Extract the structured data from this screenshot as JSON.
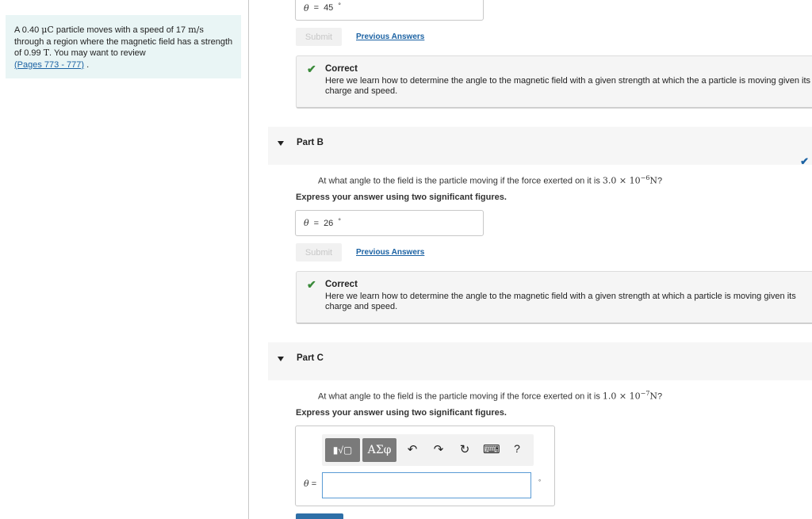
{
  "problem": {
    "text_prefix": "A 0.40 ",
    "charge_unit": "μC",
    "text_mid1": " particle moves with a speed of 17 ",
    "speed_unit": "m/s",
    "text_mid2": " through a region where the magnetic field has a strength of 0.99 ",
    "field_unit": "T",
    "text_mid3": ". You may want to review",
    "link": "(Pages 773 - 777)",
    "text_end": " ."
  },
  "partA": {
    "theta_symbol": "θ",
    "eq": "=",
    "answer": "45",
    "degree": "°",
    "submit": "Submit",
    "previous": "Previous Answers",
    "feedback_title": "Correct",
    "feedback_text": "Here we learn how to determine the angle to the magnetic field with a given strength at which the a particle is moving given its charge and speed."
  },
  "partB": {
    "label": "Part B",
    "question_prefix": "At what angle to the field is the particle moving if the force exerted on it is ",
    "force_value": "3.0 × 10",
    "force_exp": "−6",
    "force_unit": "N",
    "question_end": "?",
    "instruction": "Express your answer using two significant figures.",
    "theta_symbol": "θ",
    "eq": "=",
    "answer": "26",
    "degree": "°",
    "submit": "Submit",
    "previous": "Previous Answers",
    "feedback_title": "Correct",
    "feedback_text": "Here we learn how to determine the angle to the magnetic field with a given strength at which a particle is moving given its charge and speed."
  },
  "partC": {
    "label": "Part C",
    "question_prefix": "At what angle to the field is the particle moving if the force exerted on it is ",
    "force_value": "1.0 × 10",
    "force_exp": "−7",
    "force_unit": "N",
    "question_end": "?",
    "instruction": "Express your answer using two significant figures.",
    "theta_symbol": "θ",
    "eq": "=",
    "input_value": "",
    "unit": "°",
    "toolbar": {
      "templates_label": "▮√▢",
      "greek_label": "ΑΣφ",
      "undo": "↶",
      "redo": "↷",
      "reset": "↻",
      "keyboard": "⌨",
      "help": "?"
    }
  },
  "colors": {
    "accent": "#1b62a3",
    "correct": "#3a8a3a",
    "problem_bg": "#e9f5f5"
  }
}
